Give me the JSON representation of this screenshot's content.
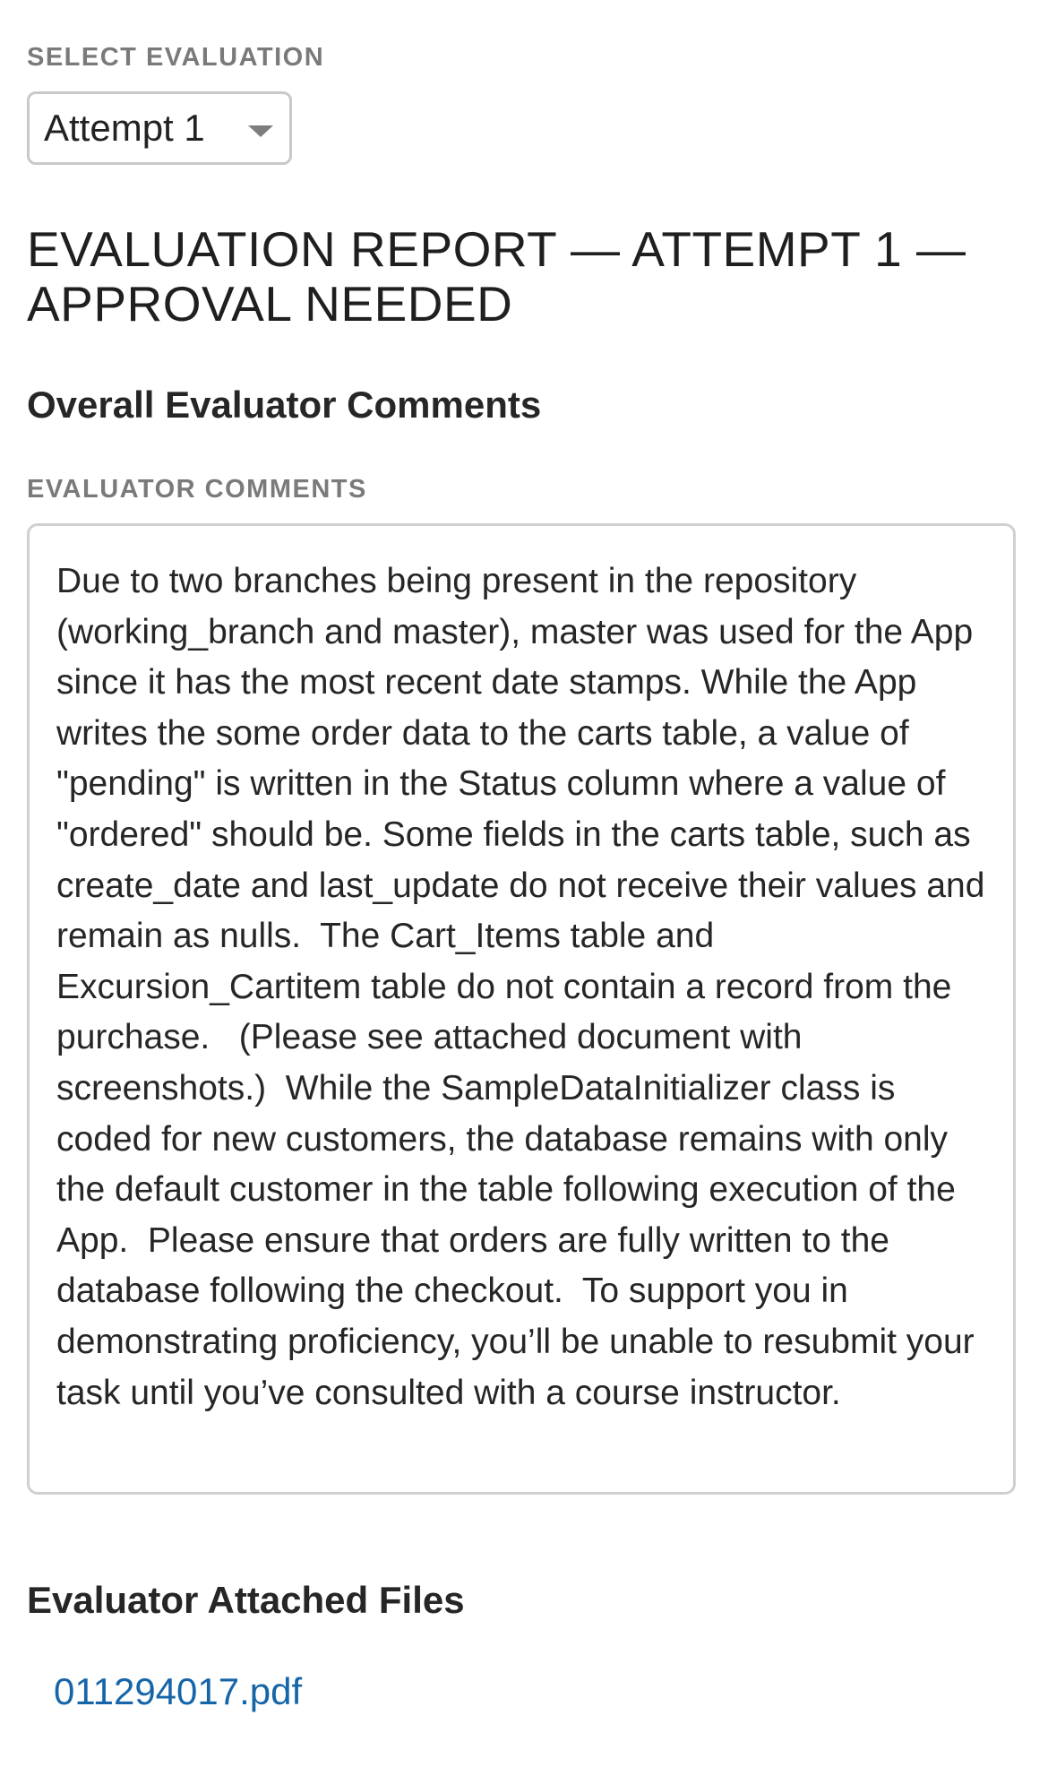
{
  "select_evaluation": {
    "label": "SELECT EVALUATION",
    "selected": "Attempt 1"
  },
  "report": {
    "title": "EVALUATION REPORT — ATTEMPT 1 — APPROVAL NEEDED"
  },
  "overall_comments": {
    "heading": "Overall Evaluator Comments",
    "label": "EVALUATOR COMMENTS",
    "text": "Due to two branches being present in the repository (working_branch and master), master was used for the App since it has the most recent date stamps. While the App writes the some order data to the carts table, a value of \"pending\" is written in the Status column where a value of \"ordered\" should be. Some fields in the carts table, such as create_date and last_update do not receive their values and remain as nulls.  The Cart_Items table and Excursion_Cartitem table do not contain a record from the purchase.   (Please see attached document with screenshots.)  While the SampleDataInitializer class is coded for new customers, the database remains with only the default customer in the table following execution of the App.  Please ensure that orders are fully written to the database following the checkout.  To support you in demonstrating proficiency, you’ll be unable to resubmit your task until you’ve consulted with a course instructor."
  },
  "attached_files": {
    "heading": "Evaluator Attached Files",
    "files": [
      {
        "name": "011294017.pdf"
      }
    ]
  },
  "colors": {
    "link": "#1565a8",
    "label_gray": "#7a7a7a",
    "border": "#d0d0d0"
  },
  "icons": {
    "select_caret": "chevron-down-icon"
  }
}
